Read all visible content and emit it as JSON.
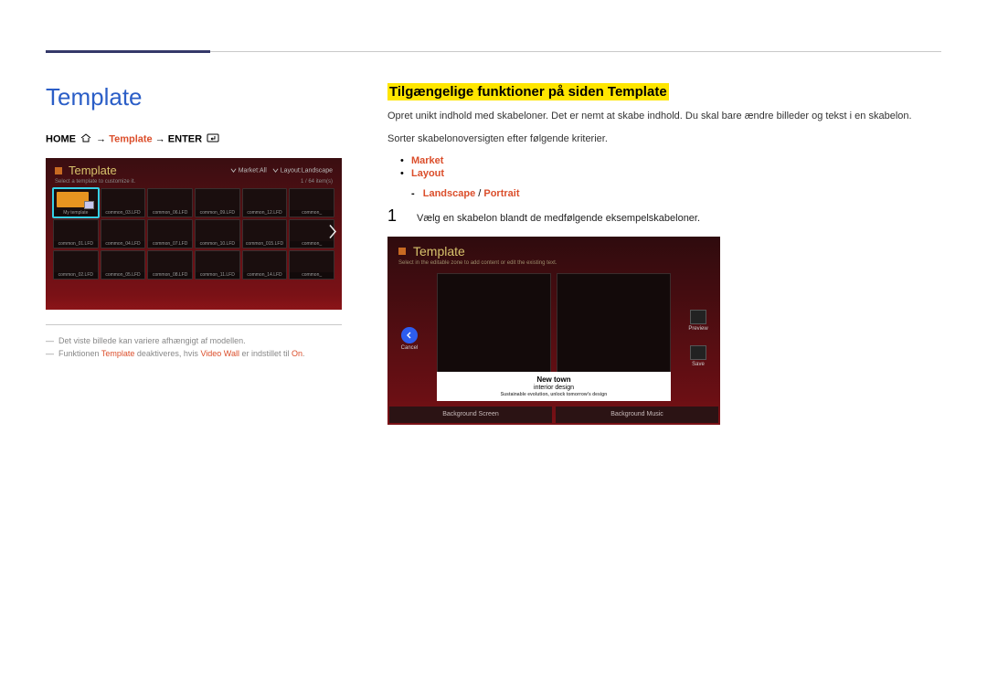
{
  "page": {
    "title": "Template",
    "breadcrumb": {
      "home": "HOME",
      "template": "Template",
      "enter": "ENTER",
      "arrow": "→"
    }
  },
  "shot1": {
    "title": "Template",
    "filter_market_label": "Market:",
    "filter_market_value": "All",
    "filter_layout_label": "Layout:",
    "filter_layout_value": "Landscape",
    "subtitle": "Select a template to customize it.",
    "counter": "1 / 64 item(s)",
    "thumbs": [
      {
        "label": "My template",
        "selected": true
      },
      {
        "label": "common_03.LFD"
      },
      {
        "label": "common_06.LFD"
      },
      {
        "label": "common_09.LFD"
      },
      {
        "label": "common_12.LFD"
      },
      {
        "label": "common_"
      },
      {
        "label": "common_01.LFD"
      },
      {
        "label": "common_04.LFD"
      },
      {
        "label": "common_07.LFD"
      },
      {
        "label": "common_10.LFD"
      },
      {
        "label": "common_015.LFD"
      },
      {
        "label": "common_"
      },
      {
        "label": "common_02.LFD"
      },
      {
        "label": "common_05.LFD"
      },
      {
        "label": "common_08.LFD"
      },
      {
        "label": "common_11.LFD"
      },
      {
        "label": "common_14.LFD"
      },
      {
        "label": "common_"
      }
    ]
  },
  "notes": {
    "n1": "Det viste billede kan variere afhængigt af modellen.",
    "n2_a": "Funktionen ",
    "n2_b": "Template",
    "n2_c": " deaktiveres, hvis ",
    "n2_d": "Video Wall",
    "n2_e": " er indstillet til ",
    "n2_f": "On",
    "n2_g": "."
  },
  "right": {
    "section_title": "Tilgængelige funktioner på siden Template",
    "p1": "Opret unikt indhold med skabeloner. Det er nemt at skabe indhold. Du skal bare ændre billeder og tekst i en skabelon.",
    "p2": "Sorter skabelonoversigten efter følgende kriterier.",
    "bullet_market": "Market",
    "bullet_layout": "Layout",
    "sub_landscape": "Landscape",
    "sub_portrait": "Portrait",
    "sub_sep": " / ",
    "step1_num": "1",
    "step1_txt": "Vælg en skabelon blandt de medfølgende eksempelskabeloner."
  },
  "shot2": {
    "title": "Template",
    "subtitle": "Select in the editable zone to add content or edit the existing text.",
    "cancel": "Cancel",
    "preview": "Preview",
    "save": "Save",
    "caption_title": "New town",
    "caption_sub": "interior design",
    "caption_tiny": "Sustainable evolution, unlock tomorrow's design",
    "foot_left": "Background Screen",
    "foot_right": "Background Music"
  }
}
